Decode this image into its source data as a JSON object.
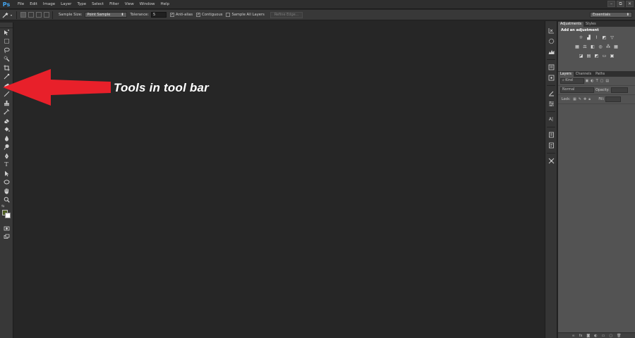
{
  "app": {
    "logo": "Ps"
  },
  "menu": [
    "File",
    "Edit",
    "Image",
    "Layer",
    "Type",
    "Select",
    "Filter",
    "View",
    "Window",
    "Help"
  ],
  "window_controls": {
    "minimize": "–",
    "restore": "⧉",
    "close": "✕"
  },
  "options": {
    "sample_size_label": "Sample Size:",
    "sample_size_value": "Point Sample",
    "tolerance_label": "Tolerance:",
    "tolerance_value": "5",
    "anti_alias_label": "Anti-alias",
    "anti_alias_checked": true,
    "contiguous_label": "Contiguous",
    "contiguous_checked": true,
    "sample_all_layers_label": "Sample All Layers",
    "sample_all_layers_checked": false,
    "refine_edge_label": "Refine Edge...",
    "workspace_value": "Essentials"
  },
  "annotation": {
    "text": "Tools in tool bar",
    "arrow_color": "#e8202a"
  },
  "panels": {
    "adjustments_tab": "Adjustments",
    "styles_tab": "Styles",
    "add_adjustment": "Add an adjustment",
    "layers_tab": "Layers",
    "channels_tab": "Channels",
    "paths_tab": "Paths",
    "kind_label": "Kind",
    "blend_mode": "Normal",
    "opacity_label": "Opacity:",
    "lock_label": "Lock:",
    "fill_label": "Fill:"
  },
  "colors": {
    "foreground_swatch": "#4e5f22",
    "background_swatch": "#ffffff",
    "canvas": "#262626",
    "logo": "#43a4ef"
  },
  "icons": {
    "toolbar": [
      "move-icon",
      "marquee-icon",
      "lasso-icon",
      "quick-selection-icon",
      "crop-icon",
      "eyedropper-icon",
      "spot-healing-icon",
      "brush-icon",
      "clone-stamp-icon",
      "history-brush-icon",
      "eraser-icon",
      "paint-bucket-icon",
      "blur-icon",
      "dodge-icon",
      "pen-icon",
      "type-icon",
      "path-selection-icon",
      "ellipse-icon",
      "hand-icon",
      "zoom-icon"
    ],
    "dock": [
      "history-icon",
      "color-wheel-icon",
      "histogram-icon",
      "info-icon",
      "brush-preset-icon",
      "properties-icon",
      "character-icon",
      "paragraph-icon",
      "notes-icon",
      "tool-presets-icon"
    ]
  }
}
